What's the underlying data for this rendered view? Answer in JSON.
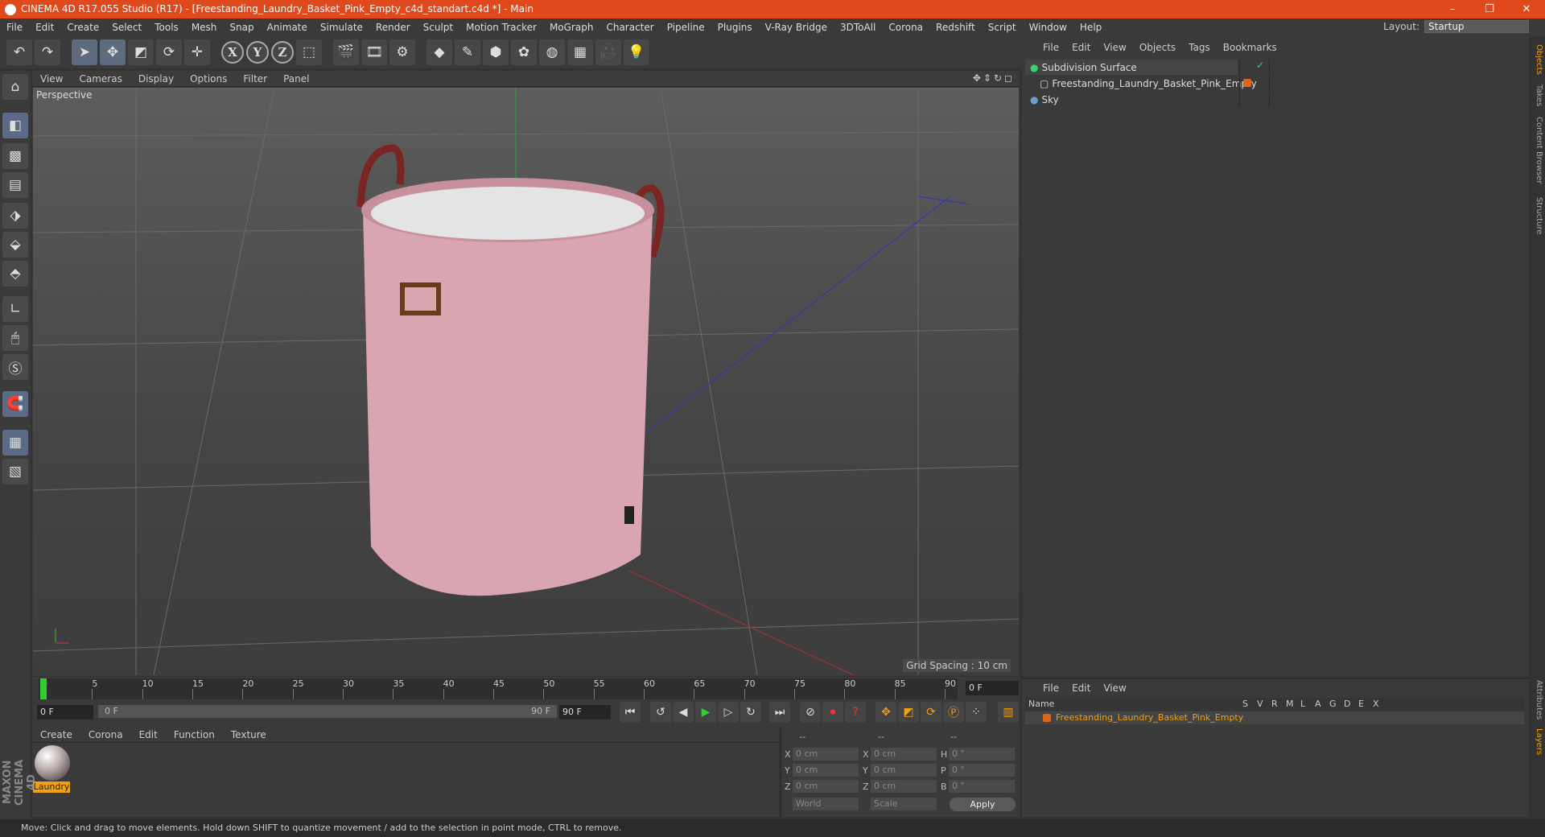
{
  "window": {
    "title": "CINEMA 4D R17.055 Studio (R17) - [Freestanding_Laundry_Basket_Pink_Empty_c4d_standart.c4d *] - Main",
    "minimize": "–",
    "restore": "❐",
    "close": "✕"
  },
  "menu": [
    "File",
    "Edit",
    "Create",
    "Select",
    "Tools",
    "Mesh",
    "Snap",
    "Animate",
    "Simulate",
    "Render",
    "Sculpt",
    "Motion Tracker",
    "MoGraph",
    "Character",
    "Pipeline",
    "Plugins",
    "V-Ray Bridge",
    "3DToAll",
    "Corona",
    "Redshift",
    "Script",
    "Window",
    "Help"
  ],
  "layout": {
    "label": "Layout:",
    "value": "Startup"
  },
  "toolbar": {
    "x": "X",
    "y": "Y",
    "z": "Z"
  },
  "viewport": {
    "menu": [
      "View",
      "Cameras",
      "Display",
      "Options",
      "Filter",
      "Panel"
    ],
    "label": "Perspective",
    "grid_spacing": "Grid Spacing : 10 cm",
    "nav_icons": "✥⇕↻◻"
  },
  "timeline": {
    "ticks": [
      "0",
      "5",
      "10",
      "15",
      "20",
      "25",
      "30",
      "35",
      "40",
      "45",
      "50",
      "55",
      "60",
      "65",
      "70",
      "75",
      "80",
      "85",
      "90"
    ],
    "current": "0 F",
    "start": "0 F",
    "slider_start": "0 F",
    "slider_end": "90 F",
    "end": "90 F"
  },
  "materials": {
    "menu": [
      "Create",
      "Corona",
      "Edit",
      "Function",
      "Texture"
    ],
    "items": [
      {
        "name": "Laundry"
      }
    ]
  },
  "coords": {
    "header": [
      "--",
      "--",
      "--"
    ],
    "rows": [
      {
        "a": "X",
        "v1": "0 cm",
        "b": "X",
        "v2": "0 cm",
        "c": "H",
        "v3": "0 °"
      },
      {
        "a": "Y",
        "v1": "0 cm",
        "b": "Y",
        "v2": "0 cm",
        "c": "P",
        "v3": "0 °"
      },
      {
        "a": "Z",
        "v1": "0 cm",
        "b": "Z",
        "v2": "0 cm",
        "c": "B",
        "v3": "0 °"
      }
    ],
    "mode": "World",
    "scale": "Scale",
    "apply": "Apply"
  },
  "objects": {
    "menu": [
      "File",
      "Edit",
      "View",
      "Objects",
      "Tags",
      "Bookmarks"
    ],
    "items": [
      {
        "name": "Subdivision Surface",
        "color": "#3bd16f"
      },
      {
        "name": "Freestanding_Laundry_Basket_Pink_Empty",
        "color": "#d9d9d9"
      },
      {
        "name": "Sky",
        "color": "#6aa0d8"
      }
    ]
  },
  "layers": {
    "menu": [
      "File",
      "Edit",
      "View"
    ],
    "headers": [
      "Name",
      "S",
      "V",
      "R",
      "M",
      "L",
      "A",
      "G",
      "D",
      "E",
      "X"
    ],
    "row": {
      "name": "Freestanding_Laundry_Basket_Pink_Empty",
      "color": "#d9661f"
    }
  },
  "side_tabs": [
    "Objects",
    "Takes",
    "Content Browser",
    "Structure",
    "Attributes",
    "Layers"
  ],
  "brand": "MAXON CINEMA 4D",
  "status": "Move: Click and drag to move elements. Hold down SHIFT to quantize movement / add to the selection in point mode, CTRL to remove."
}
